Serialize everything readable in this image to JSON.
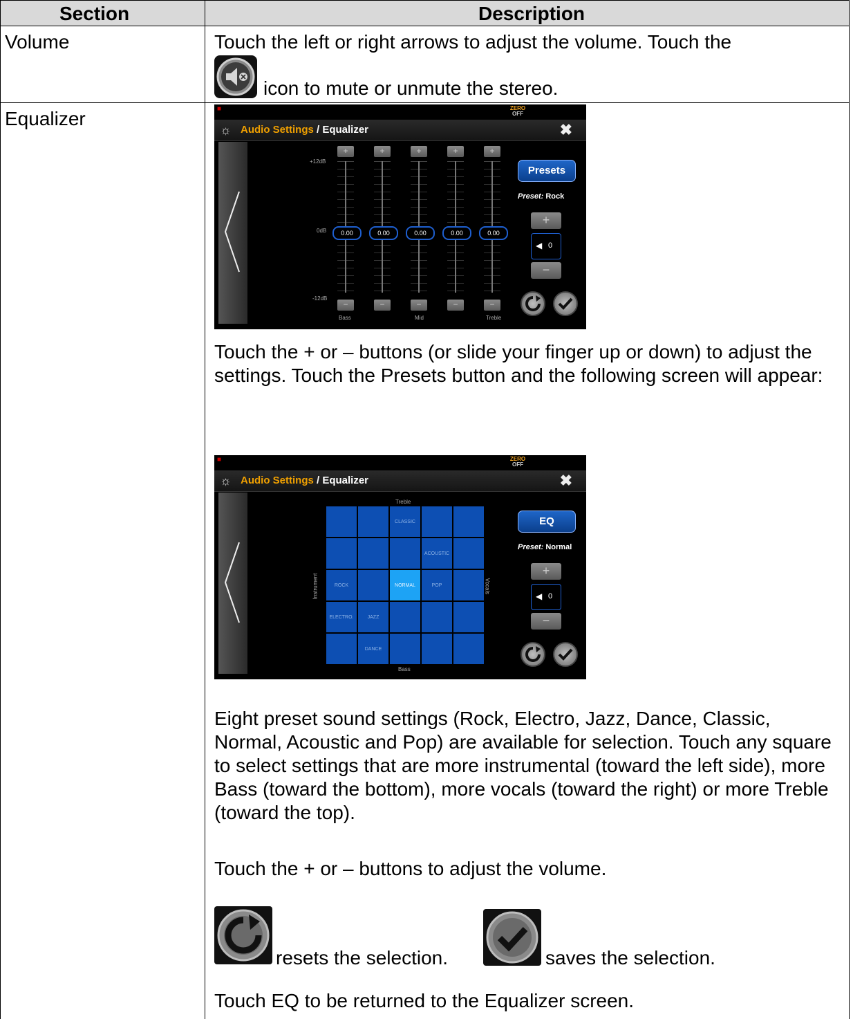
{
  "table": {
    "headers": [
      "Section",
      "Description"
    ]
  },
  "rows": {
    "volume": {
      "section": "Volume",
      "line1": "Touch the left or right arrows to adjust the volume.  Touch the",
      "line2": "icon to mute or unmute the stereo.",
      "icon": "mute-speaker-icon"
    },
    "equalizer": {
      "section": "Equalizer",
      "para1": "Touch the + or – buttons (or slide your finger up or down) to adjust the settings.  Touch the Presets button and the following screen will appear:",
      "para2": "Eight preset sound settings (Rock, Electro, Jazz, Dance, Classic, Normal, Acoustic and Pop) are available for selection.  Touch any square to select settings that are more instrumental (toward the left side), more Bass (toward the bottom), more vocals (toward the right) or more Treble (toward the top).",
      "para3": "Touch the + or – buttons to adjust the volume.",
      "reset_text": "resets the selection.",
      "save_text": "saves the selection.",
      "para4": "Touch EQ to be returned to the Equalizer screen."
    }
  },
  "screen_common": {
    "brand_top": "ZERO",
    "brand_bottom": "OFF",
    "title_prefix": "Audio Settings",
    "title_suffix": " / Equalizer",
    "close_glyph": "✖",
    "gear_glyph": "☼",
    "volume_value": "0",
    "plus": "+",
    "minus": "−"
  },
  "eq_screen": {
    "presets_button": "Presets",
    "preset_label": "Preset:",
    "preset_value": "Rock",
    "db_top": "+12dB",
    "db_mid": "0dB",
    "db_bottom": "-12dB",
    "bands": [
      {
        "value": "0.00",
        "label": "Bass"
      },
      {
        "value": "0.00",
        "label": ""
      },
      {
        "value": "0.00",
        "label": "Mid"
      },
      {
        "value": "0.00",
        "label": ""
      },
      {
        "value": "0.00",
        "label": "Treble"
      }
    ]
  },
  "preset_screen": {
    "eq_button": "EQ",
    "preset_label": "Preset:",
    "preset_value": "Normal",
    "axis_top": "Treble",
    "axis_bottom": "Bass",
    "axis_left": "Instrument",
    "axis_right": "Vocals",
    "grid": [
      [
        "",
        "",
        "CLASSIC",
        "",
        ""
      ],
      [
        "",
        "",
        "",
        "ACOUSTIC",
        ""
      ],
      [
        "ROCK",
        "",
        "NORMAL",
        "POP",
        ""
      ],
      [
        "ELECTRO.",
        "JAZZ",
        "",
        "",
        ""
      ],
      [
        "",
        "DANCE",
        "",
        "",
        ""
      ]
    ],
    "selected": "NORMAL"
  },
  "colors": {
    "header_bg": "#d9d9d9",
    "title_orange": "#f0a000",
    "button_blue": "#1f66c8",
    "grid_blue": "#0d4fb3",
    "grid_selected": "#1da3f5"
  }
}
